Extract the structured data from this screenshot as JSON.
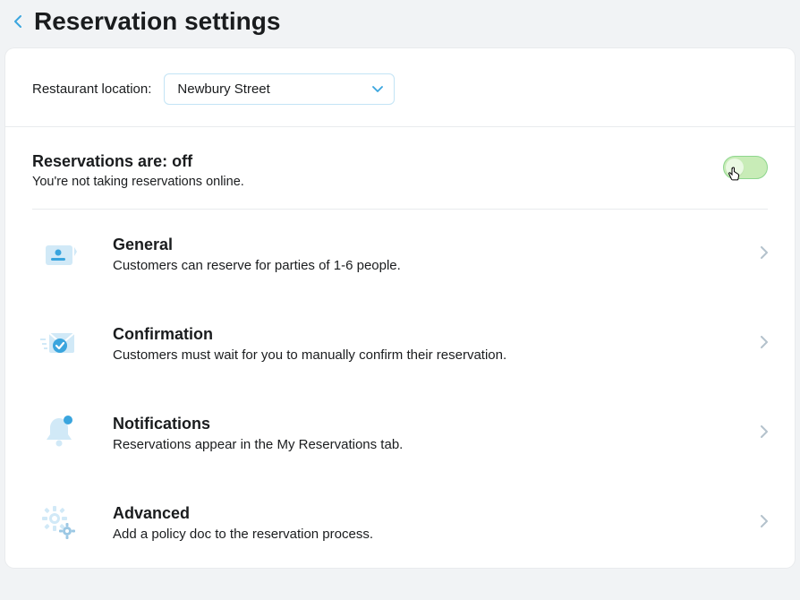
{
  "page": {
    "title": "Reservation settings"
  },
  "location": {
    "label": "Restaurant location:",
    "value": "Newbury Street"
  },
  "status": {
    "title": "Reservations are: off",
    "description": "You're not taking reservations online."
  },
  "sections": [
    {
      "title": "General",
      "desc": "Customers can reserve for parties of 1-6 people."
    },
    {
      "title": "Confirmation",
      "desc": "Customers must wait for you to manually confirm their reservation."
    },
    {
      "title": "Notifications",
      "desc": "Reservations appear in the My Reservations tab."
    },
    {
      "title": "Advanced",
      "desc": "Add a policy doc to the reservation process."
    }
  ]
}
